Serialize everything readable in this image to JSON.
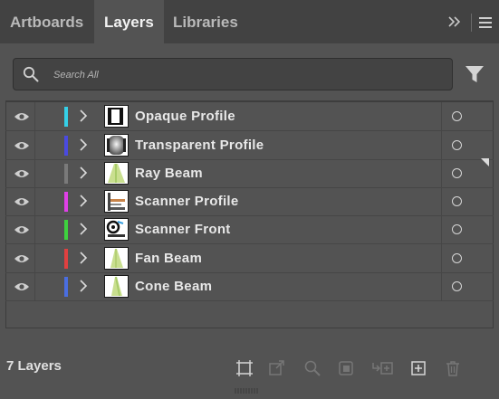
{
  "tabs": [
    {
      "label": "Artboards",
      "active": false
    },
    {
      "label": "Layers",
      "active": true
    },
    {
      "label": "Libraries",
      "active": false
    }
  ],
  "search": {
    "placeholder": "Search All",
    "value": ""
  },
  "layers": [
    {
      "name": "Opaque Profile",
      "color": "#35d0e8"
    },
    {
      "name": "Transparent Profile",
      "color": "#4a4ae0"
    },
    {
      "name": "Ray Beam",
      "color": "#7a7a7a"
    },
    {
      "name": "Scanner Profile",
      "color": "#e040e8"
    },
    {
      "name": "Scanner Front",
      "color": "#3ed23e"
    },
    {
      "name": "Fan Beam",
      "color": "#e04040"
    },
    {
      "name": "Cone Beam",
      "color": "#4a6ee0"
    }
  ],
  "footer": {
    "layer_count": "7 Layers"
  },
  "icons": {
    "panel_menu": "hamburger-icon",
    "collapse": "double-chevron-icon",
    "search": "search-icon",
    "filter": "filter-icon",
    "visibility": "eye-icon",
    "expand": "chevron-right-icon",
    "target": "circle-target-icon",
    "footer": [
      "artboard-icon",
      "export-icon",
      "locate-object-icon",
      "clipping-mask-icon",
      "new-sublayer-icon",
      "new-layer-icon",
      "trash-icon"
    ]
  }
}
